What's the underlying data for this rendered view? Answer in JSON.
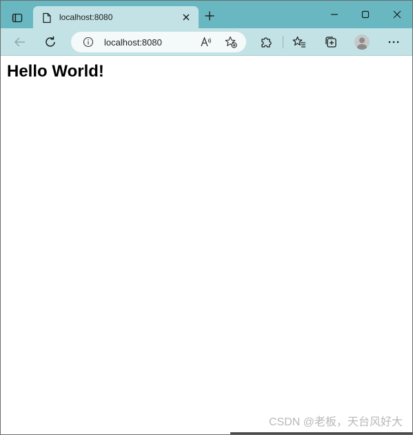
{
  "browser": {
    "tab": {
      "title": "localhost:8080",
      "favicon": "page-icon"
    },
    "address_bar": {
      "url": "localhost:8080",
      "info_icon": "info-icon"
    },
    "icons": {
      "tab_actions": "tab-actions-icon",
      "close_tab": "close-icon",
      "new_tab": "plus-icon",
      "minimize": "minimize-icon",
      "maximize": "maximize-icon",
      "close_window": "close-icon",
      "back": "back-arrow-icon",
      "refresh": "refresh-icon",
      "read_aloud": "read-aloud-icon",
      "add_favorite": "add-favorite-icon",
      "extensions": "puzzle-icon",
      "favorites": "favorites-icon",
      "collections": "collections-icon",
      "profile": "avatar",
      "more": "more-icon"
    },
    "colors": {
      "tab_strip": "#69b8c1",
      "toolbar": "#c3e2e6",
      "address_bar": "#f4f9fa"
    }
  },
  "page": {
    "heading": "Hello World!"
  },
  "watermark": "CSDN @老板，天台风好大"
}
